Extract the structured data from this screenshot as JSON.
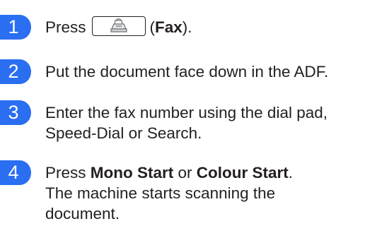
{
  "accent_color": "#2a6ef2",
  "steps": [
    {
      "number": "1",
      "parts": {
        "before": "Press",
        "open_paren": "(",
        "bold": "Fax",
        "after": ")."
      },
      "key_icon": "fax-machine-icon"
    },
    {
      "number": "2",
      "text": "Put the document face down in the ADF."
    },
    {
      "number": "3",
      "line1": "Enter the fax number using the dial pad,",
      "line2": "Speed-Dial or Search."
    },
    {
      "number": "4",
      "line1": {
        "before": "Press ",
        "bold1": "Mono Start",
        "middle": " or ",
        "bold2": "Colour Start",
        "after": "."
      },
      "line2": "The machine starts scanning the",
      "line3": "document."
    }
  ]
}
